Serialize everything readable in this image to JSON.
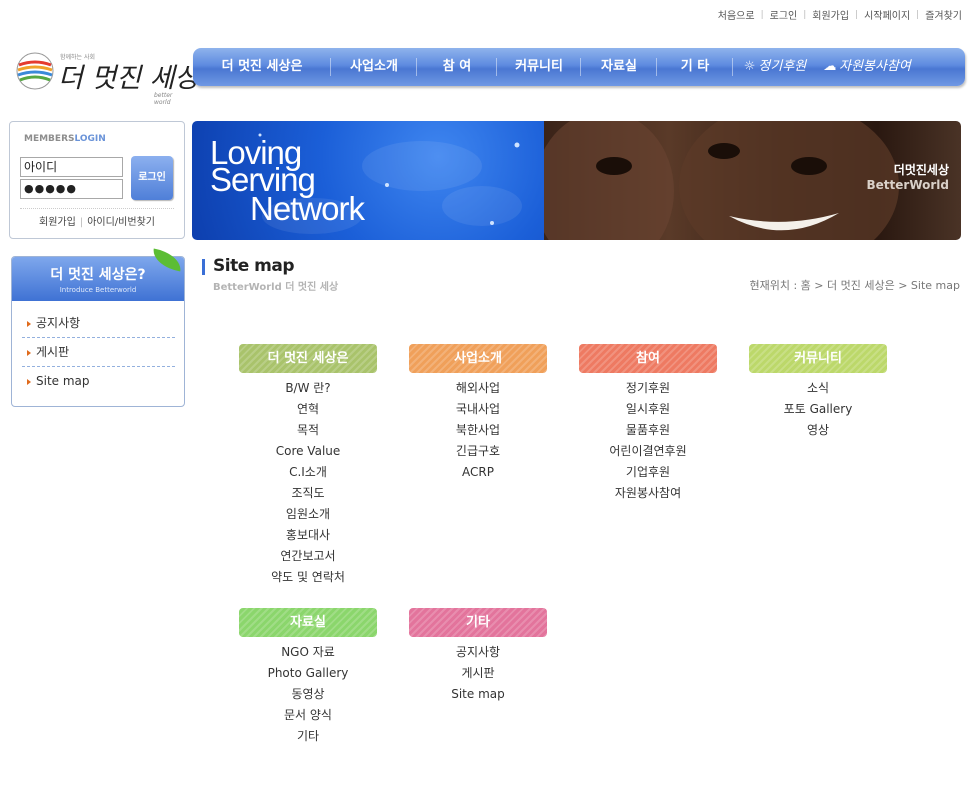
{
  "util_links": [
    "처음으로",
    "로그인",
    "회원가입",
    "시작페이지",
    "즐겨찾기"
  ],
  "logo": {
    "name": "더 멋진 세상",
    "tagline_ko": "함께하는 사회",
    "tagline_en": "better world"
  },
  "gnb": {
    "items": [
      "더 멋진 세상은",
      "사업소개",
      "참 여",
      "커뮤니티",
      "자료실",
      "기 타"
    ],
    "special": [
      "정기후원",
      "자원봉사참여"
    ]
  },
  "login": {
    "title_members": "MEMBERS",
    "title_login": "LOGIN",
    "id_placeholder": "아이디",
    "pw_value": "●●●●●",
    "button": "로그인",
    "join": "회원가입",
    "find": "아이디/비번찾기"
  },
  "banner": {
    "line1": "Loving",
    "line2": "Serving",
    "line3": "Network",
    "brand_ko": "더멋진세상",
    "brand_en": "BetterWorld"
  },
  "lnb": {
    "title": "더 멋진 세상은?",
    "subtitle": "Introduce Betterworld",
    "items": [
      "공지사항",
      "게시판",
      "Site map"
    ]
  },
  "page": {
    "title": "Site map",
    "subtitle": "BetterWorld 더 멋진 세상",
    "breadcrumb": "현재위치 : 홈 > 더 멋진 세상은 > Site map"
  },
  "sitemap": [
    {
      "title": "더 멋진 세상은",
      "color": "#a9c36b",
      "items": [
        "B/W 란?",
        "연혁",
        "목적",
        "Core Value",
        "C.I소개",
        "조직도",
        "임원소개",
        "홍보대사",
        "연간보고서",
        "약도 및 연락처"
      ]
    },
    {
      "title": "사업소개",
      "color": "#f0a05a",
      "items": [
        "해외사업",
        "국내사업",
        "북한사업",
        "긴급구호",
        "ACRP"
      ]
    },
    {
      "title": "참여",
      "color": "#ee7a62",
      "items": [
        "정기후원",
        "일시후원",
        "물품후원",
        "어린이결연후원",
        "기업후원",
        "자원봉사참여"
      ]
    },
    {
      "title": "커뮤니티",
      "color": "#bcd86a",
      "items": [
        "소식",
        "포토 Gallery",
        "영상"
      ]
    },
    {
      "title": "자료실",
      "color": "#8bd66c",
      "items": [
        "NGO 자료",
        "Photo Gallery",
        "동영상",
        "문서 양식",
        "기타"
      ]
    },
    {
      "title": "기타",
      "color": "#e3749c",
      "items": [
        "공지사항",
        "게시판",
        "Site map"
      ]
    }
  ]
}
